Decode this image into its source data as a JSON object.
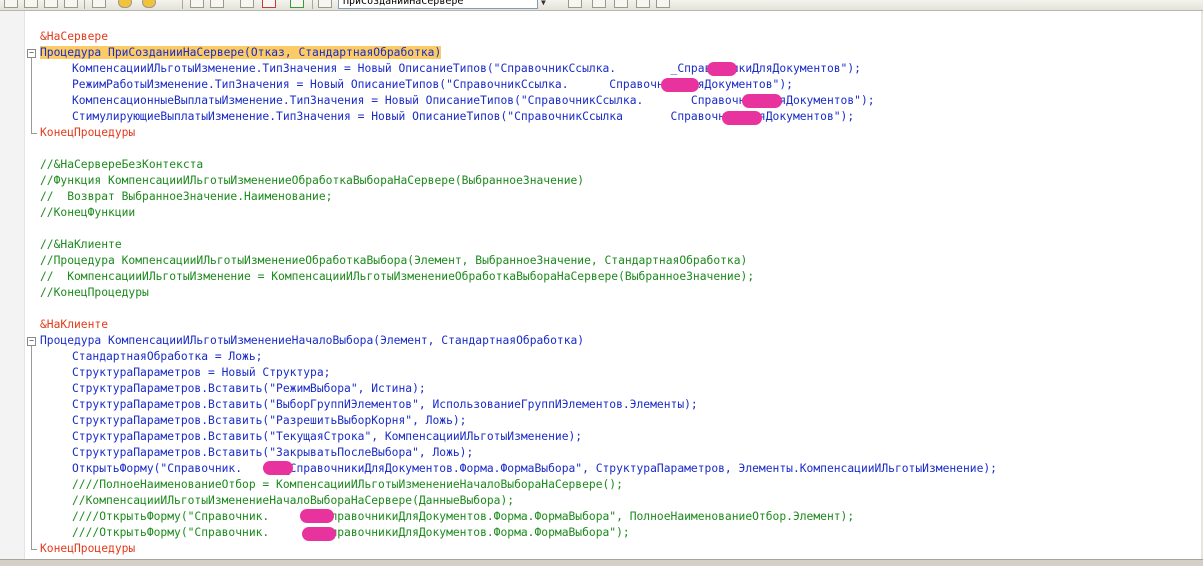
{
  "toolbar": {
    "module_selector_value": "ПриСозданииНаСервере"
  },
  "code_lines": [
    "&НаСервере",
    "Процедура ПриСозданииНаСервере(Отказ, СтандартнаяОбработка)",
    "КомпенсацииИЛьготыИзменение.ТипЗначения = Новый ОписаниеТипов(\"СправочникСсылка.        _СправочникиДляДокументов\");",
    "РежимРаботыИзменение.ТипЗначения = Новый ОписаниеТипов(\"СправочникСсылка.      СправочникиДляДокументов\");",
    "КомпенсационныеВыплатыИзменение.ТипЗначения = Новый ОписаниеТипов(\"СправочникСсылка.       СправочникиДляДокументов\");",
    "СтимулирующиеВыплатыИзменение.ТипЗначения = Новый ОписаниеТипов(\"СправочникСсылка       СправочникиДляДокументов\");",
    "КонецПроцедуры",
    "//&НаСервереБезКонтекста",
    "//Функция КомпенсацииИЛьготыИзменениеОбработкаВыбораНаСервере(ВыбранноеЗначение)",
    "//  Возврат ВыбранноеЗначение.Наименование;",
    "//КонецФункции",
    "//&НаКлиенте",
    "//Процедура КомпенсацииИЛьготыИзменениеОбработкаВыбора(Элемент, ВыбранноеЗначение, СтандартнаяОбработка)",
    "//  КомпенсацииИЛьготыИзменение = КомпенсацииИЛьготыИзменениеОбработкаВыбораНаСервере(ВыбранноеЗначение);",
    "//КонецПроцедуры",
    "&НаКлиенте",
    "Процедура КомпенсацииИЛьготыИзменениеНачалоВыбора(Элемент, СтандартнаяОбработка)",
    "СтандартнаяОбработка = Ложь;",
    "СтруктураПараметров = Новый Структура;",
    "СтруктураПараметров.Вставить(\"РежимВыбора\", Истина);",
    "СтруктураПараметров.Вставить(\"ВыборГруппИЭлементов\", ИспользованиеГруппИЭлементов.Элементы);",
    "СтруктураПараметров.Вставить(\"РазрешитьВыборКорня\", Ложь);",
    "СтруктураПараметров.Вставить(\"ТекущаяСтрока\", КомпенсацииИЛьготыИзменение);",
    "СтруктураПараметров.Вставить(\"ЗакрыватьПослеВыбора\", Ложь);",
    "ОткрытьФорму(\"Справочник.      _СправочникиДляДокументов.Форма.ФормаВыбора\", СтруктураПараметров, Элементы.КомпенсацииИЛьготыИзменение);",
    "////ПолноеНаименованиеОтбор = КомпенсацииИЛьготыИзменениеНачалоВыбораНаСервере();",
    "//КомпенсацииИЛьготыИзменениеНачалоВыбораНаСервере(ДанныеВыбора);",
    "////ОткрытьФорму(\"Справочник.        СправочникиДляДокументов.Форма.ФормаВыбора\", ПолноеНаименованиеОтбор.Элемент);",
    "////ОткрытьФорму(\"Справочник.        СправочникиДляДокументов.Форма.ФормаВыбора\");",
    "КонецПроцедуры"
  ]
}
